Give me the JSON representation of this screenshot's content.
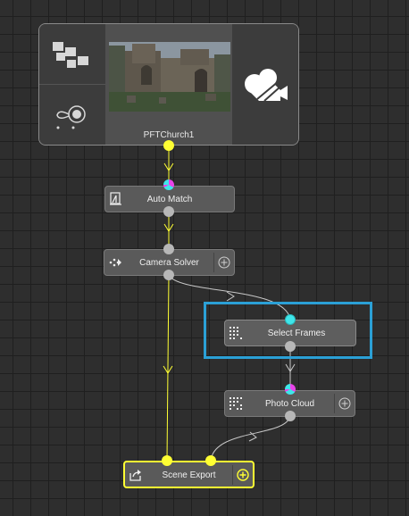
{
  "clip_node": {
    "name": "PFTChurch1"
  },
  "nodes": {
    "auto_match": {
      "label": "Auto Match"
    },
    "camera_solver": {
      "label": "Camera Solver"
    },
    "select_frames": {
      "label": "Select Frames"
    },
    "photo_cloud": {
      "label": "Photo Cloud"
    },
    "scene_export": {
      "label": "Scene Export"
    }
  },
  "colors": {
    "canvas": "#2e2e2e",
    "grid": "#1f1f1f",
    "node": "#5a5a5a",
    "clip_wire": "#ffff33",
    "camera_wire": "#c8c8c8",
    "selection": "#2ba0d6"
  },
  "icons": [
    "mosaic-icon",
    "tracker-icon",
    "camera-icon",
    "auto-match-icon",
    "camera-solver-icon",
    "select-frames-icon",
    "photo-cloud-icon",
    "export-icon",
    "plus-icon"
  ]
}
